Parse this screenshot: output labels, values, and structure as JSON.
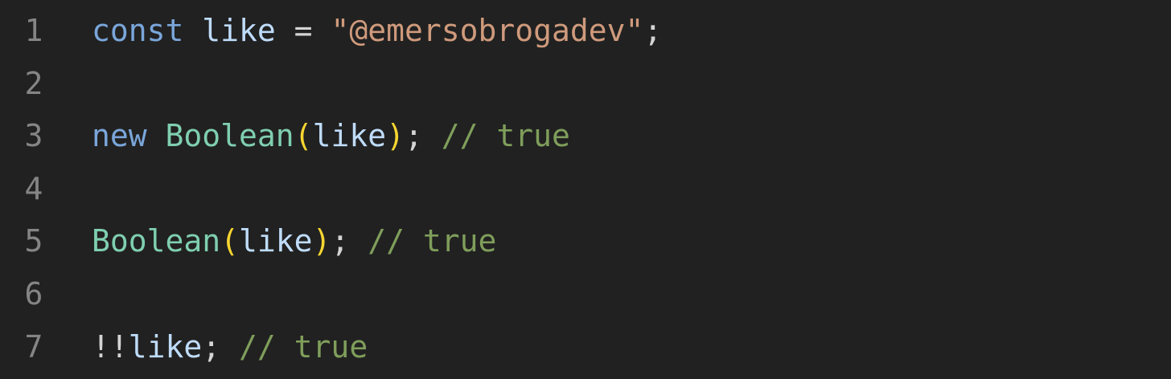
{
  "editor": {
    "lines": [
      {
        "number": "1",
        "tokens": [
          {
            "text": "const",
            "type": "kw"
          },
          {
            "text": " ",
            "type": "pun"
          },
          {
            "text": "like",
            "type": "id"
          },
          {
            "text": " = ",
            "type": "op"
          },
          {
            "text": "\"@emersobrogadev\"",
            "type": "str"
          },
          {
            "text": ";",
            "type": "pun"
          }
        ]
      },
      {
        "number": "2",
        "tokens": []
      },
      {
        "number": "3",
        "tokens": [
          {
            "text": "new",
            "type": "kw"
          },
          {
            "text": " ",
            "type": "pun"
          },
          {
            "text": "Boolean",
            "type": "cls"
          },
          {
            "text": "(",
            "type": "paren"
          },
          {
            "text": "like",
            "type": "id"
          },
          {
            "text": ")",
            "type": "paren"
          },
          {
            "text": "; ",
            "type": "pun"
          },
          {
            "text": "// true",
            "type": "cmt"
          }
        ]
      },
      {
        "number": "4",
        "tokens": []
      },
      {
        "number": "5",
        "tokens": [
          {
            "text": "Boolean",
            "type": "cls"
          },
          {
            "text": "(",
            "type": "paren"
          },
          {
            "text": "like",
            "type": "id"
          },
          {
            "text": ")",
            "type": "paren"
          },
          {
            "text": "; ",
            "type": "pun"
          },
          {
            "text": "// true",
            "type": "cmt"
          }
        ]
      },
      {
        "number": "6",
        "tokens": []
      },
      {
        "number": "7",
        "tokens": [
          {
            "text": "!!",
            "type": "op"
          },
          {
            "text": "like",
            "type": "id"
          },
          {
            "text": "; ",
            "type": "pun"
          },
          {
            "text": "// true",
            "type": "cmt"
          }
        ]
      }
    ]
  },
  "colors": {
    "background": "#212121",
    "line_number": "#858585",
    "keyword": "#7aa6da",
    "identifier": "#bfdcfa",
    "string": "#cf9a7c",
    "class": "#7fcfb0",
    "paren": "#f6d531",
    "comment": "#7f9e5b"
  }
}
